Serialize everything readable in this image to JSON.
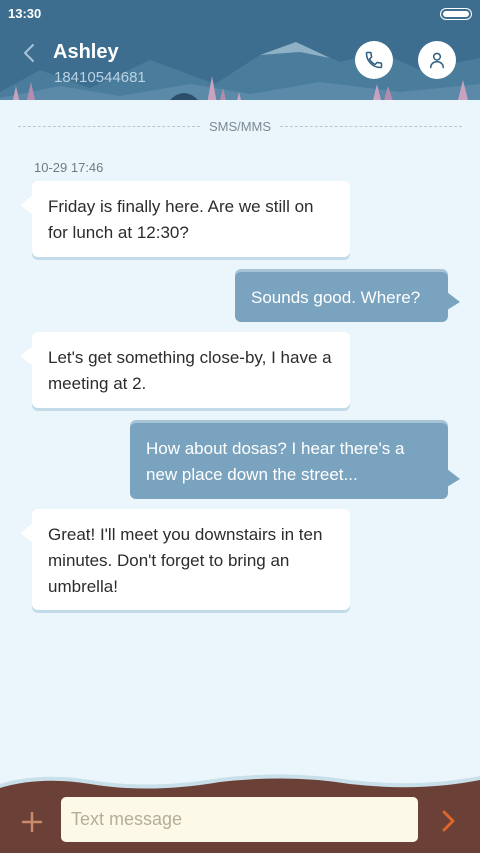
{
  "status_bar": {
    "time": "13:30"
  },
  "header": {
    "contact_name": "Ashley",
    "contact_number": "18410544681",
    "back_icon": "chevron-left-icon",
    "call_icon": "phone-icon",
    "profile_icon": "person-icon"
  },
  "conversation": {
    "channel_label": "SMS/MMS",
    "timestamp": "10-29 17:46",
    "messages": [
      {
        "direction": "incoming",
        "text": "Friday is finally here. Are we still on for lunch at 12:30?"
      },
      {
        "direction": "outgoing",
        "text": "Sounds good. Where?"
      },
      {
        "direction": "incoming",
        "text": "Let's get something close-by, I have a meeting at 2."
      },
      {
        "direction": "outgoing",
        "text": "How about dosas? I hear there's a new place down the street..."
      },
      {
        "direction": "incoming",
        "text": "Great! I'll meet you downstairs in ten minutes. Don't forget to bring an umbrella!"
      }
    ]
  },
  "composer": {
    "placeholder": "Text message",
    "value": "",
    "add_icon": "plus-icon",
    "send_icon": "chevron-right-icon"
  },
  "colors": {
    "header_bg": "#3d6e8f",
    "background": "#eaf6fc",
    "incoming_bubble": "#ffffff",
    "outgoing_bubble": "#7aa3bf",
    "footer_bg": "#6b4036",
    "send_accent": "#e0672b"
  }
}
